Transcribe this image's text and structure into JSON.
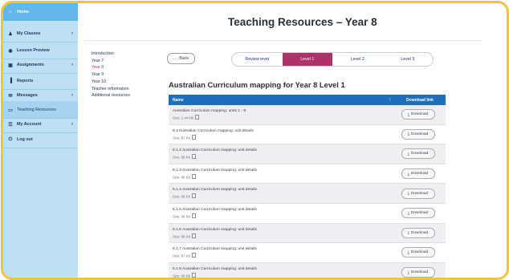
{
  "sidebar": {
    "items": [
      {
        "label": "Home",
        "icon": "home-icon",
        "glyph": "⌂",
        "chevron": false
      },
      {
        "label": "My Classes",
        "icon": "graduation-cap-icon",
        "glyph": "♟",
        "chevron": true
      },
      {
        "label": "Lesson Preview",
        "icon": "eye-icon",
        "glyph": "◉",
        "chevron": false
      },
      {
        "label": "Assignments",
        "icon": "briefcase-icon",
        "glyph": "▣",
        "chevron": true
      },
      {
        "label": "Reports",
        "icon": "bar-chart-icon",
        "glyph": "▐",
        "chevron": false
      },
      {
        "label": "Messages",
        "icon": "envelope-icon",
        "glyph": "✉",
        "chevron": true
      },
      {
        "label": "Teaching Resources",
        "icon": "folder-icon",
        "glyph": "▭",
        "chevron": false
      },
      {
        "label": "My Account",
        "icon": "users-icon",
        "glyph": "☰",
        "chevron": true
      },
      {
        "label": "Log out",
        "icon": "power-icon",
        "glyph": "⏻",
        "chevron": false
      }
    ],
    "chevron_glyph": "›"
  },
  "header": {
    "title": "Teaching Resources – Year 8"
  },
  "subnav": {
    "items": [
      "Introduction",
      "Year 7",
      "Year 8",
      "Year 9",
      "Year 10",
      "Teacher information",
      "Additional resources"
    ],
    "active": "Year 8"
  },
  "back_button": {
    "label": "Back",
    "icon": "back-arrow-icon",
    "glyph": "←"
  },
  "tabs": {
    "items": [
      "Review level",
      "Level 1",
      "Level 2",
      "Level 3"
    ],
    "active": "Level 1"
  },
  "section_heading": "Australian Curriculum mapping for Year 8 Level 1",
  "table": {
    "headers": {
      "name": "Name",
      "download": "Download link"
    },
    "sort_glyph": "↕",
    "download_label": "Download",
    "download_glyph": "⤓",
    "rows": [
      {
        "name": "Australian Curriculum mapping: units 1 - 8",
        "size": "Size: 1.44 Mb"
      },
      {
        "name": "8.1 Australian Curriculum mapping: unit details",
        "size": "Size: 97 Kb"
      },
      {
        "name": "8.1.2 Australian Curriculum mapping: unit details",
        "size": "Size: 98 Kb"
      },
      {
        "name": "8.1.3 Australian Curriculum mapping: unit details",
        "size": "Size: 98 Kb"
      },
      {
        "name": "8.1.4 Australian Curriculum mapping: unit details",
        "size": "Size: 96 Kb"
      },
      {
        "name": "8.1.5 Australian Curriculum mapping: unit details",
        "size": "Size: 96 Kb"
      },
      {
        "name": "8.1.6 Australian Curriculum mapping: unit details",
        "size": "Size: 98 Kb"
      },
      {
        "name": "8.1.7 Australian Curriculum mapping: unit details",
        "size": "Size: 97 Kb"
      },
      {
        "name": "8.1.8 Australian Curriculum mapping: unit details",
        "size": "Size: 98 Kb"
      }
    ]
  },
  "colors": {
    "frame": "#f5c33b",
    "sidebar": "#bfe0f4",
    "sidebar_active": "#62b6ea",
    "accent": "#b0306a",
    "table_header": "#1e6ec0"
  }
}
